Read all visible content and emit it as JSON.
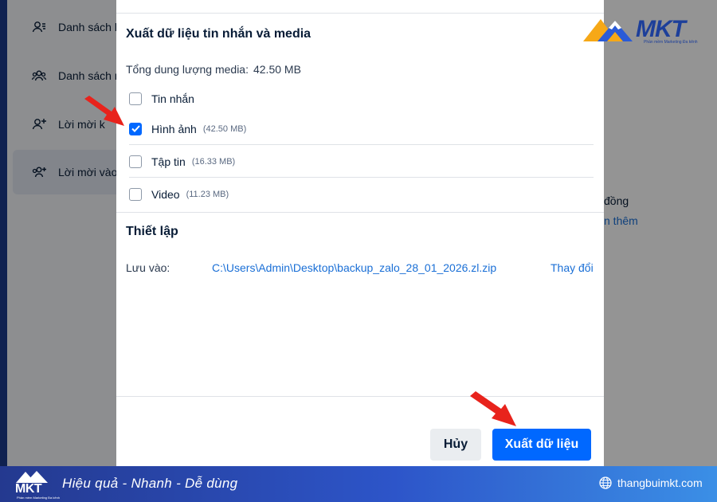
{
  "sidebar": {
    "items": [
      {
        "label": "Danh sách b",
        "icon": "contact-list-icon"
      },
      {
        "label": "Danh sách n",
        "icon": "group-list-icon"
      },
      {
        "label": "Lời mời k",
        "icon": "friend-request-icon"
      },
      {
        "label": "Lời mời vào",
        "icon": "group-invite-icon"
      }
    ]
  },
  "background": {
    "right_text_1": "đồng",
    "right_link_1": "n thêm"
  },
  "modal": {
    "section_export_title": "Xuất dữ liệu tin nhắn và media",
    "total_label": "Tổng dung lượng media:",
    "total_value": "42.50 MB",
    "options": [
      {
        "label": "Tin nhắn",
        "size": "",
        "checked": false
      },
      {
        "label": "Hình ảnh",
        "size": "(42.50 MB)",
        "checked": true
      },
      {
        "label": "Tập tin",
        "size": "(16.33 MB)",
        "checked": false
      },
      {
        "label": "Video",
        "size": "(11.23 MB)",
        "checked": false
      }
    ],
    "section_settings_title": "Thiết lập",
    "save_label": "Lưu vào:",
    "save_path": "C:\\Users\\Admin\\Desktop\\backup_zalo_28_01_2026.zl.zip",
    "change_label": "Thay đổi",
    "cancel_label": "Hủy",
    "export_label": "Xuất dữ liệu"
  },
  "brand": {
    "logo_word": "MKT",
    "logo_tagline": "Phần mềm Marketing Đa kênh",
    "banner_slogan": "Hiệu quả - Nhanh  - Dễ dùng",
    "banner_site": "thangbuimkt.com"
  },
  "colors": {
    "primary": "#0068ff",
    "link": "#1a6fd6",
    "arrow": "#e8231c",
    "banner_start": "#24398f",
    "banner_end": "#3b8fe6"
  }
}
